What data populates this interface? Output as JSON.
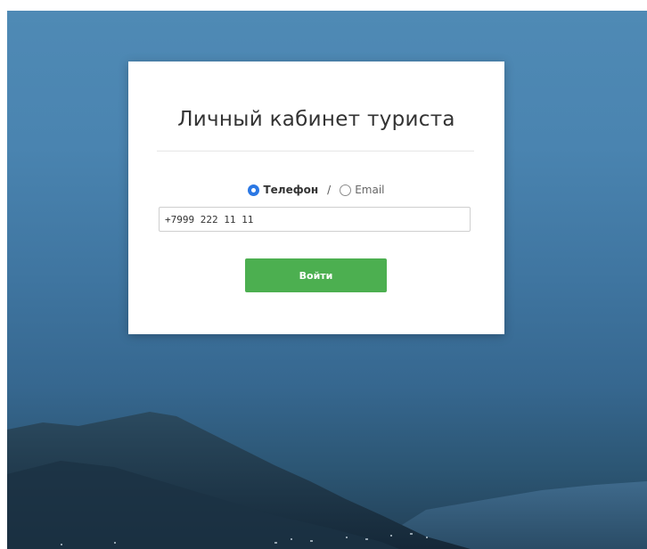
{
  "login": {
    "title": "Личный кабинет туриста",
    "options": {
      "phone_label": "Телефон",
      "separator": "/",
      "email_label": "Email",
      "selected": "phone"
    },
    "phone_value": "+7999 222 11 11",
    "submit_label": "Войти"
  },
  "colors": {
    "accent": "#2b78e4",
    "button": "#4caf50",
    "sky": "#4a84b0"
  }
}
